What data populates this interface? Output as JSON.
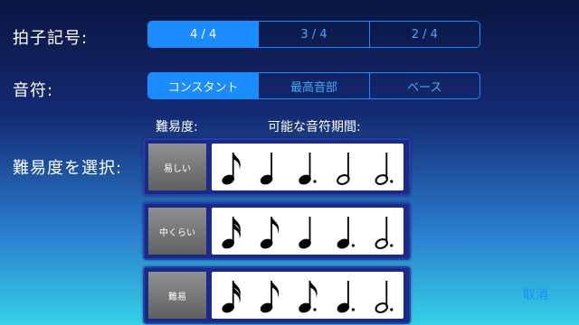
{
  "time_signature": {
    "label": "拍子記号:",
    "options": [
      "4 / 4",
      "3 / 4",
      "2 / 4"
    ],
    "selected": "4 / 4"
  },
  "note": {
    "label": "音符:",
    "options": [
      "コンスタント",
      "最高音部",
      "ベース"
    ],
    "selected": "コンスタント"
  },
  "difficulty": {
    "label": "難易度を選択:",
    "col_difficulty": "難易度:",
    "col_durations": "可能な音符期間:",
    "levels": [
      {
        "label": "易しい",
        "notes": [
          "eighth",
          "quarter",
          "dotted-quarter",
          "half",
          "dotted-half"
        ]
      },
      {
        "label": "中くらい",
        "notes": [
          "sixteenth",
          "eighth",
          "quarter",
          "dotted-quarter",
          "dotted-half"
        ]
      },
      {
        "label": "難易",
        "notes": [
          "sixteenth",
          "eighth",
          "dotted-eighth",
          "dotted-quarter",
          "dotted-half"
        ]
      }
    ]
  },
  "cancel_label": "取消",
  "colors": {
    "accent": "#1a8cff",
    "card": "#1a2a88"
  }
}
